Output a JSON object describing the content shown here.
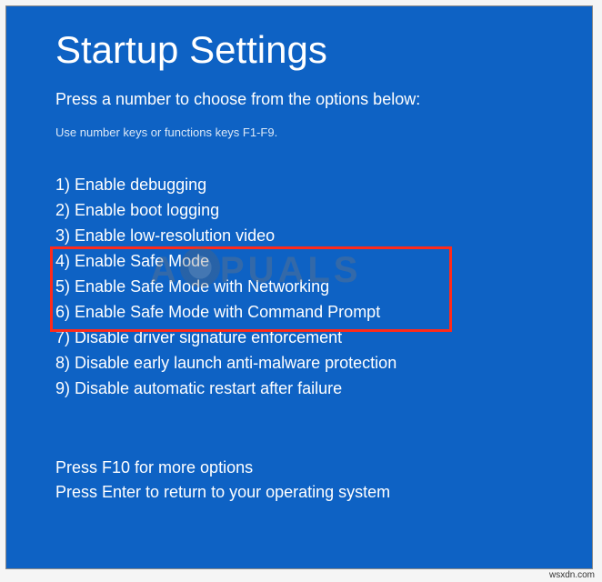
{
  "title": "Startup Settings",
  "subtitle": "Press a number to choose from the options below:",
  "hint": "Use number keys or functions keys F1-F9.",
  "options": [
    {
      "num": "1)",
      "label": "Enable debugging",
      "highlighted": false
    },
    {
      "num": "2)",
      "label": "Enable boot logging",
      "highlighted": false
    },
    {
      "num": "3)",
      "label": "Enable low-resolution video",
      "highlighted": false
    },
    {
      "num": "4)",
      "label": "Enable Safe Mode",
      "highlighted": true
    },
    {
      "num": "5)",
      "label": "Enable Safe Mode with Networking",
      "highlighted": true
    },
    {
      "num": "6)",
      "label": "Enable Safe Mode with Command Prompt",
      "highlighted": true
    },
    {
      "num": "7)",
      "label": "Disable driver signature enforcement",
      "highlighted": false
    },
    {
      "num": "8)",
      "label": "Disable early launch anti-malware protection",
      "highlighted": false
    },
    {
      "num": "9)",
      "label": "Disable automatic restart after failure",
      "highlighted": false
    }
  ],
  "footer": {
    "line1": "Press F10 for more options",
    "line2": "Press Enter to return to your operating system"
  },
  "watermark": {
    "pre": "A",
    "post": "PUALS"
  },
  "attribution": "wsxdn.com"
}
